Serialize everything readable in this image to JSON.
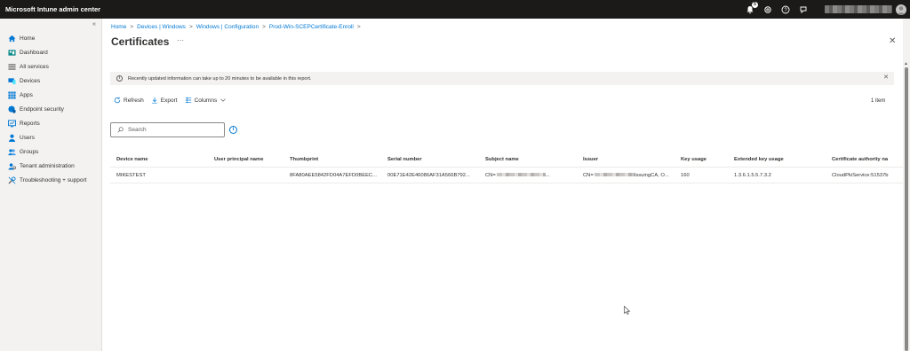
{
  "app": {
    "title": "Microsoft Intune admin center",
    "notification_count": "5"
  },
  "sidebar": {
    "items": [
      {
        "label": "Home",
        "icon": "home-icon"
      },
      {
        "label": "Dashboard",
        "icon": "dashboard-icon"
      },
      {
        "label": "All services",
        "icon": "all-services-icon"
      },
      {
        "label": "Devices",
        "icon": "devices-icon"
      },
      {
        "label": "Apps",
        "icon": "apps-icon"
      },
      {
        "label": "Endpoint security",
        "icon": "endpoint-security-icon"
      },
      {
        "label": "Reports",
        "icon": "reports-icon"
      },
      {
        "label": "Users",
        "icon": "users-icon"
      },
      {
        "label": "Groups",
        "icon": "groups-icon"
      },
      {
        "label": "Tenant administration",
        "icon": "tenant-admin-icon"
      },
      {
        "label": "Troubleshooting + support",
        "icon": "troubleshooting-icon"
      }
    ]
  },
  "breadcrumb": [
    "Home",
    "Devices | Windows",
    "Windows | Configuration",
    "Prod-Win-SCEPCertificate-Enroll"
  ],
  "page": {
    "title": "Certificates",
    "more": "···"
  },
  "banner": {
    "text": "Recently updated information can take up to 20 minutes to be available in this report."
  },
  "toolbar": {
    "refresh": "Refresh",
    "export": "Export",
    "columns": "Columns",
    "item_count": "1 item"
  },
  "search": {
    "placeholder": "Search"
  },
  "table": {
    "columns": [
      "Device name",
      "User principal name",
      "Thumbprint",
      "Serial number",
      "Subject name",
      "Issuer",
      "Key usage",
      "Extended key usage",
      "Certificate authority na"
    ],
    "rows": [
      {
        "device_name": "MIKESTEST",
        "user_principal_name": "",
        "thumbprint": "8FA80AEE5842FD04A7EFD0BEEC...",
        "serial_number": "00E71E42E46086AF31A566B792...",
        "subject_prefix": "CN=",
        "subject_suffix": "...",
        "issuer_prefix": "CN=",
        "issuer_suffix": "IssuingCA, O...",
        "key_usage": "160",
        "extended_key_usage": "1.3.6.1.5.5.7.3.2",
        "certificate_authority": "CloudPkiService:51537b"
      }
    ]
  },
  "colors": {
    "topbar": "#1b1a19",
    "sidebar": "#f3f2f1",
    "accent": "#0078d4",
    "banner": "#f3f2f1"
  }
}
